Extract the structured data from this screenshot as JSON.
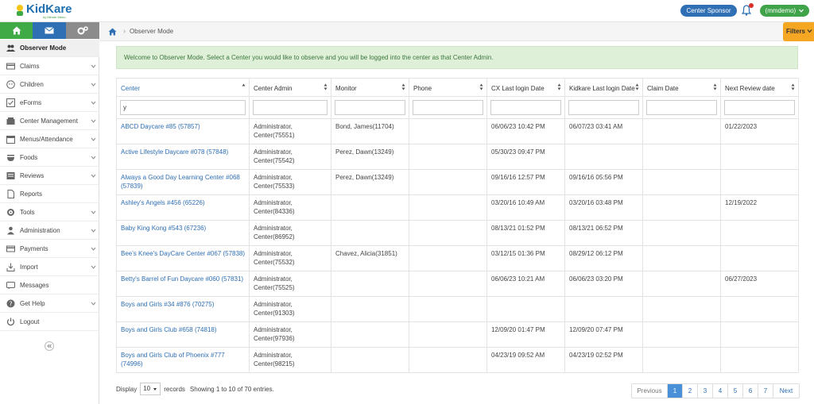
{
  "app": {
    "logo_text": "KidKare",
    "logo_tagline": "by Minute Menu"
  },
  "topbar": {
    "sponsor_label": "Center Sponsor",
    "user_label": "(mmdemo)"
  },
  "sidebar": {
    "items": [
      {
        "label": "Observer Mode",
        "icon": "users-icon",
        "active": true
      },
      {
        "label": "Claims",
        "icon": "claims-icon"
      },
      {
        "label": "Children",
        "icon": "child-icon"
      },
      {
        "label": "eForms",
        "icon": "checkbox-icon"
      },
      {
        "label": "Center Management",
        "icon": "center-icon"
      },
      {
        "label": "Menus/Attendance",
        "icon": "calendar-icon"
      },
      {
        "label": "Foods",
        "icon": "foods-icon"
      },
      {
        "label": "Reviews",
        "icon": "reviews-icon"
      },
      {
        "label": "Reports",
        "icon": "reports-icon"
      },
      {
        "label": "Tools",
        "icon": "tools-icon"
      },
      {
        "label": "Administration",
        "icon": "admin-icon"
      },
      {
        "label": "Payments",
        "icon": "payments-icon"
      },
      {
        "label": "Import",
        "icon": "import-icon"
      },
      {
        "label": "Messages",
        "icon": "messages-icon"
      },
      {
        "label": "Get Help",
        "icon": "help-icon"
      },
      {
        "label": "Logout",
        "icon": "logout-icon"
      }
    ]
  },
  "breadcrumb": {
    "current": "Observer Mode",
    "filters_label": "Filters"
  },
  "alert": {
    "text": "Welcome to Observer Mode. Select a Center you would like to observe and you will be logged into the center as that Center Admin."
  },
  "table": {
    "columns": [
      "Center",
      "Center Admin",
      "Monitor",
      "Phone",
      "CX Last login Date",
      "Kidkare Last login Date",
      "Claim Date",
      "Next Review date"
    ],
    "filters": [
      "y",
      "",
      "",
      "",
      "",
      "",
      "",
      ""
    ],
    "rows": [
      {
        "center": "ABCD Daycare #85 (57857)",
        "admin": "Administrator, Center(75551)",
        "monitor": "Bond, James(11704)",
        "phone": "",
        "cx": "06/06/23 10:42 PM",
        "kk": "06/07/23 03:41 AM",
        "claim": "",
        "review": "01/22/2023"
      },
      {
        "center": "Active Lifestyle Daycare #078 (57848)",
        "admin": "Administrator, Center(75542)",
        "monitor": "Perez, Dawn(13249)",
        "phone": "",
        "cx": "05/30/23 09:47 PM",
        "kk": "",
        "claim": "",
        "review": ""
      },
      {
        "center": "Always a Good Day Learning Center #068 (57839)",
        "admin": "Administrator, Center(75533)",
        "monitor": "Perez, Dawn(13249)",
        "phone": "",
        "cx": "09/16/16 12:57 PM",
        "kk": "09/16/16 05:56 PM",
        "claim": "",
        "review": ""
      },
      {
        "center": "Ashley's Angels #456 (65226)",
        "admin": "Administrator, Center(84336)",
        "monitor": "",
        "phone": "",
        "cx": "03/20/16 10:49 AM",
        "kk": "03/20/16 03:48 PM",
        "claim": "",
        "review": "12/19/2022"
      },
      {
        "center": "Baby King Kong #543 (67236)",
        "admin": "Administrator, Center(86952)",
        "monitor": "",
        "phone": "",
        "cx": "08/13/21 01:52 PM",
        "kk": "08/13/21 06:52 PM",
        "claim": "",
        "review": ""
      },
      {
        "center": "Bee's Knee's DayCare Center #067 (57838)",
        "admin": "Administrator, Center(75532)",
        "monitor": "Chavez, Alicia(31851)",
        "phone": "",
        "cx": "03/12/15 01:36 PM",
        "kk": "08/29/12 06:12 PM",
        "claim": "",
        "review": ""
      },
      {
        "center": "Betty's Barrel of Fun Daycare #060 (57831)",
        "admin": "Administrator, Center(75525)",
        "monitor": "",
        "phone": "",
        "cx": "06/06/23 10:21 AM",
        "kk": "06/06/23 03:20 PM",
        "claim": "",
        "review": "06/27/2023"
      },
      {
        "center": "Boys and Girls #34 #876 (70275)",
        "admin": "Administrator, Center(91303)",
        "monitor": "",
        "phone": "",
        "cx": "",
        "kk": "",
        "claim": "",
        "review": ""
      },
      {
        "center": "Boys and Girls Club #658 (74818)",
        "admin": "Administrator, Center(97936)",
        "monitor": "",
        "phone": "",
        "cx": "12/09/20 01:47 PM",
        "kk": "12/09/20 07:47 PM",
        "claim": "",
        "review": ""
      },
      {
        "center": "Boys and Girls Club of Phoenix #777 (74996)",
        "admin": "Administrator, Center(98215)",
        "monitor": "",
        "phone": "",
        "cx": "04/23/19 09:52 AM",
        "kk": "04/23/19 02:52 PM",
        "claim": "",
        "review": ""
      }
    ]
  },
  "footer": {
    "display_label": "Display",
    "page_size": "10",
    "records_label": "records",
    "showing_text": "Showing 1 to 10 of 70 entries."
  },
  "pagination": {
    "prev": "Previous",
    "pages": [
      "1",
      "2",
      "3",
      "4",
      "5",
      "6",
      "7"
    ],
    "active": "1",
    "next": "Next"
  },
  "colors": {
    "green": "#3faa46",
    "blue": "#2f6fb4",
    "orange": "#f5a623",
    "alert_bg": "#dff0d8"
  }
}
